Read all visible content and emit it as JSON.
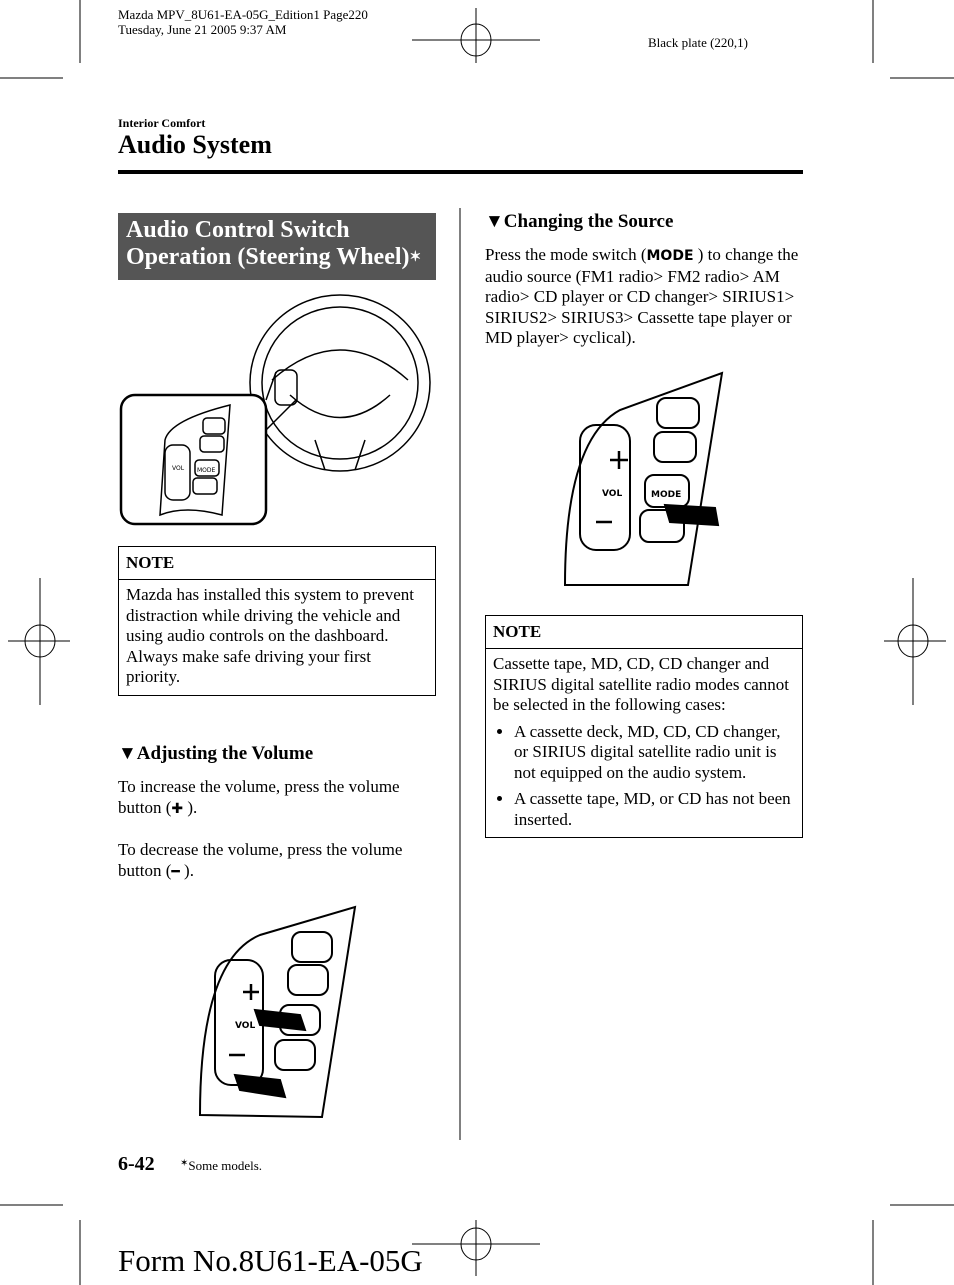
{
  "print_header": {
    "line1": "Mazda MPV_8U61-EA-05G_Edition1 Page220",
    "line2": "Tuesday, June 21 2005 9:37 AM",
    "plate": "Black plate (220,1)"
  },
  "section": "Interior Comfort",
  "title": "Audio System",
  "box_heading": {
    "line1": "Audio Control Switch",
    "line2": "Operation (Steering Wheel)",
    "mark": "✶"
  },
  "note1": {
    "title": "NOTE",
    "body": "Mazda has installed this system to prevent distraction while driving the vehicle and using audio controls on the dashboard.",
    "body2": "Always make safe driving your first priority."
  },
  "volume": {
    "heading": "▼Adjusting the Volume",
    "p1_before": "To increase the volume, press the volume button (",
    "p1_icon": "✚",
    "p1_after": " ).",
    "p2_before": "To decrease the volume, press the volume button (",
    "p2_icon": "━",
    "p2_after": " )."
  },
  "source": {
    "heading": "▼Changing the Source",
    "p_before": "Press the mode switch (",
    "p_icon": "MODE",
    "p_after": " ) to change the audio source (FM1 radio> FM2 radio> AM radio> CD player or CD changer> SIRIUS1> SIRIUS2> SIRIUS3> Cassette tape player or MD player> cyclical)."
  },
  "note2": {
    "title": "NOTE",
    "body": "Cassette tape, MD, CD, CD changer and SIRIUS digital satellite radio modes cannot be selected in the following cases:",
    "bullets": [
      "A cassette deck, MD, CD, CD changer, or SIRIUS digital satellite radio unit is not equipped on the audio system.",
      "A cassette tape, MD, or CD has not been inserted."
    ]
  },
  "illustration_labels": {
    "vol": "VOL",
    "mode": "MODE"
  },
  "footer": {
    "page_number": "6-42",
    "footnote_mark": "✶",
    "footnote": "Some models."
  },
  "form_number": "Form No.8U61-EA-05G"
}
